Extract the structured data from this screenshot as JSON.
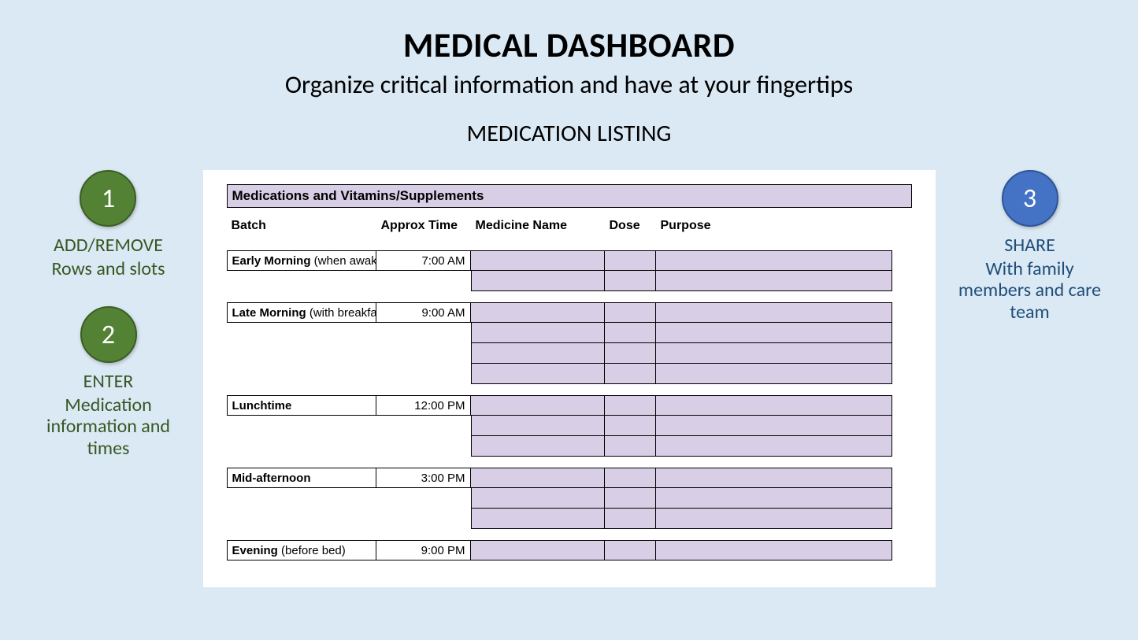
{
  "header": {
    "title": "MEDICAL DASHBOARD",
    "subtitle": "Organize critical information and have at your fingertips",
    "section": "MEDICATION LISTING"
  },
  "left": {
    "step1": {
      "num": "1",
      "title": "ADD/REMOVE",
      "desc": "Rows and slots"
    },
    "step2": {
      "num": "2",
      "title": "ENTER",
      "desc": "Medication information and times"
    }
  },
  "right": {
    "step3": {
      "num": "3",
      "title": "SHARE",
      "desc": "With family members and care team"
    }
  },
  "sheet": {
    "heading": "Medications and Vitamins/Supplements",
    "columns": {
      "batch": "Batch",
      "time": "Approx Time",
      "medicine": "Medicine Name",
      "dose": "Dose",
      "purpose": "Purpose"
    },
    "batches": [
      {
        "name_bold": "Early Morning",
        "name_rest": " (when awake)",
        "time": "7:00 AM",
        "rows": 2
      },
      {
        "name_bold": "Late Morning",
        "name_rest": " (with breakfast)",
        "time": "9:00 AM",
        "rows": 4
      },
      {
        "name_bold": "Lunchtime",
        "name_rest": "",
        "time": "12:00 PM",
        "rows": 3
      },
      {
        "name_bold": "Mid-afternoon",
        "name_rest": "",
        "time": "3:00 PM",
        "rows": 3
      },
      {
        "name_bold": "Evening",
        "name_rest": " (before bed)",
        "time": "9:00 PM",
        "rows": 1
      }
    ]
  }
}
